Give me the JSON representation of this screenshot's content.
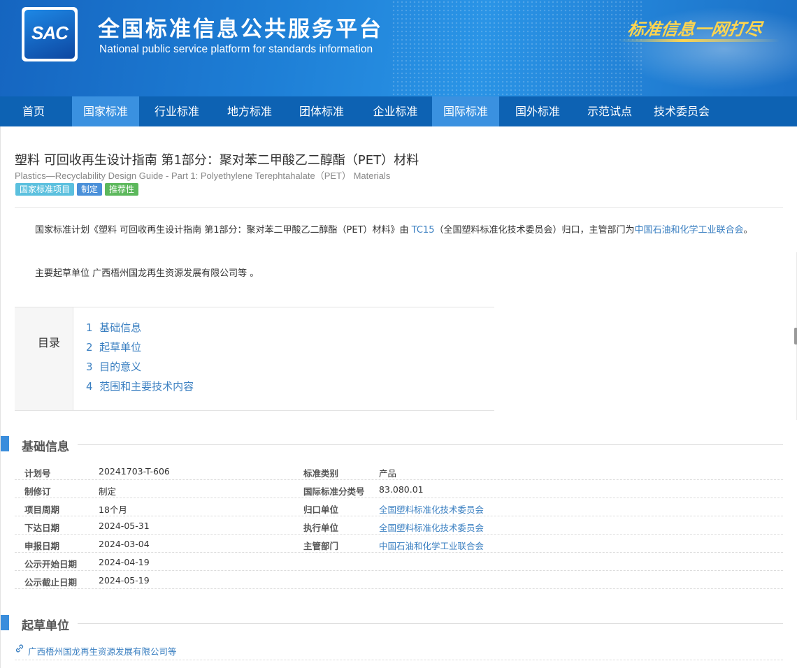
{
  "header": {
    "logo_text": "SAC",
    "title_cn": "全国标准信息公共服务平台",
    "title_en": "National public service platform  for standards information",
    "slogan": "标准信息一网打尽"
  },
  "nav": {
    "items": [
      {
        "label": "首页",
        "active": false
      },
      {
        "label": "国家标准",
        "active": true
      },
      {
        "label": "行业标准",
        "active": false
      },
      {
        "label": "地方标准",
        "active": false
      },
      {
        "label": "团体标准",
        "active": false
      },
      {
        "label": "企业标准",
        "active": false
      },
      {
        "label": "国际标准",
        "active": true
      },
      {
        "label": "国外标准",
        "active": false
      },
      {
        "label": "示范试点",
        "active": false
      },
      {
        "label": "技术委员会",
        "active": false
      }
    ]
  },
  "standard": {
    "title_cn": "塑料 可回收再生设计指南 第1部分：聚对苯二甲酸乙二醇酯（PET）材料",
    "title_en": "Plastics—Recyclability Design Guide - Part 1: Polyethylene Terephtahalate（PET） Materials",
    "tags": [
      "国家标准项目",
      "制定",
      "推荐性"
    ]
  },
  "intro": {
    "p1_prefix": "国家标准计划《塑料 可回收再生设计指南 第1部分：聚对苯二甲酸乙二醇酯（PET）材料》由 ",
    "p1_tc_link": "TC15",
    "p1_middle": "（全国塑料标准化技术委员会）归口，主管部门为",
    "p1_dept_link": "中国石油和化学工业联合会",
    "p1_suffix": "。",
    "p2": "主要起草单位 广西梧州国龙再生资源发展有限公司等 。"
  },
  "toc": {
    "label": "目录",
    "items": [
      {
        "num": "1",
        "text": "基础信息"
      },
      {
        "num": "2",
        "text": "起草单位"
      },
      {
        "num": "3",
        "text": "目的意义"
      },
      {
        "num": "4",
        "text": "范围和主要技术内容"
      }
    ]
  },
  "basic_info": {
    "heading": "基础信息",
    "rows": [
      {
        "k1": "计划号",
        "v1": "20241703-T-606",
        "k2": "标准类别",
        "v2": "产品",
        "v2_link": false
      },
      {
        "k1": "制修订",
        "v1": "制定",
        "k2": "国际标准分类号",
        "v2": "83.080.01",
        "v2_link": false
      },
      {
        "k1": "项目周期",
        "v1": "18个月",
        "k2": "归口单位",
        "v2": "全国塑料标准化技术委员会",
        "v2_link": true
      },
      {
        "k1": "下达日期",
        "v1": "2024-05-31",
        "k2": "执行单位",
        "v2": "全国塑料标准化技术委员会",
        "v2_link": true
      },
      {
        "k1": "申报日期",
        "v1": "2024-03-04",
        "k2": "主管部门",
        "v2": "中国石油和化学工业联合会",
        "v2_link": true
      },
      {
        "k1": "公示开始日期",
        "v1": "2024-04-19",
        "k2": "",
        "v2": "",
        "v2_link": false
      },
      {
        "k1": "公示截止日期",
        "v1": "2024-05-19",
        "k2": "",
        "v2": "",
        "v2_link": false
      }
    ]
  },
  "drafting": {
    "heading": "起草单位",
    "units": [
      "广西梧州国龙再生资源发展有限公司等"
    ]
  },
  "colors": {
    "nav_bg": "#0d62b3",
    "nav_active": "#3a91e0",
    "link": "#3a7fc1",
    "section_bar": "#3a8ddc"
  }
}
